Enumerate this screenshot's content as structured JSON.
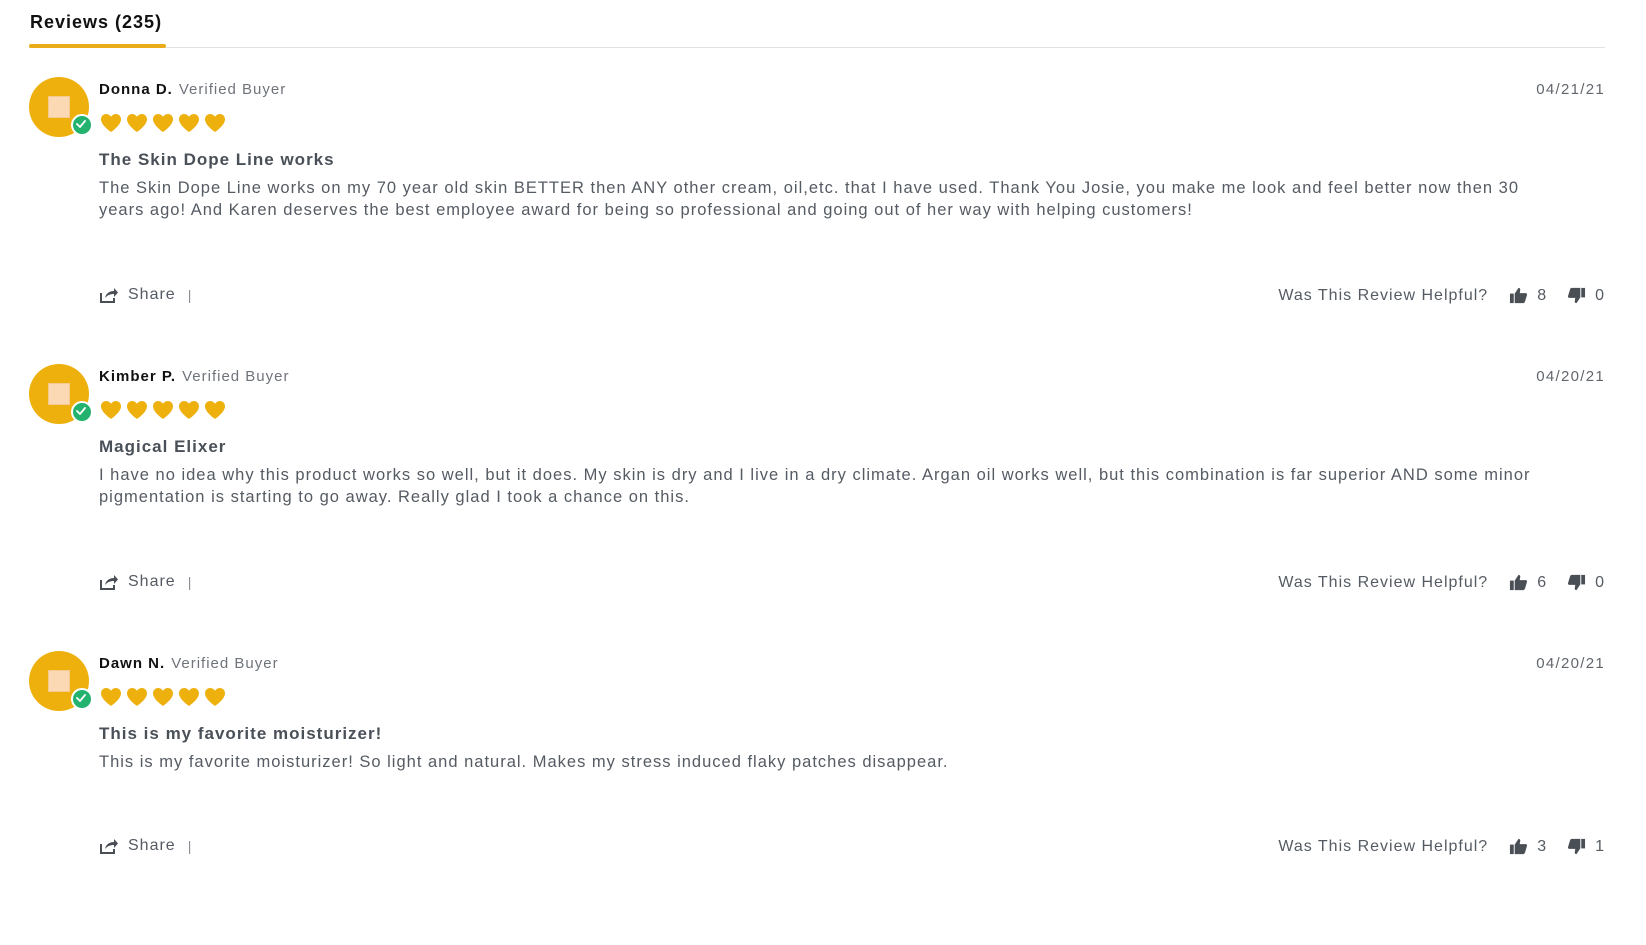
{
  "tabs": {
    "reviews_label": "Reviews (235)"
  },
  "colors": {
    "accent": "#eaac1b",
    "star": "#edb00c",
    "verified": "#23b36f"
  },
  "icons": {
    "rating": "heart-icon",
    "verified": "check-circle-icon",
    "share": "share-icon",
    "upvote": "thumbs-up-icon",
    "downvote": "thumbs-down-icon"
  },
  "reviews": [
    {
      "author": "Donna D.",
      "verified_label": "Verified Buyer",
      "date": "04/21/21",
      "rating": 5,
      "title": "The Skin Dope Line works",
      "body": "The Skin Dope Line works on my 70 year old skin BETTER then ANY other cream, oil,etc. that I have used. Thank You Josie, you make me look and feel better now then 30 years ago! And Karen deserves the best employee award for being so professional and going out of her way with helping customers!",
      "share_label": "Share",
      "divider": "|",
      "helpful_question": "Was This Review Helpful?",
      "helpful_yes": "8",
      "helpful_no": "0"
    },
    {
      "author": "Kimber P.",
      "verified_label": "Verified Buyer",
      "date": "04/20/21",
      "rating": 5,
      "title": "Magical Elixer",
      "body": "I have no idea why this product works so well, but it does. My skin is dry and I live in a dry climate. Argan oil works well, but this combination is far superior AND some minor pigmentation is starting to go away. Really glad I took a chance on this.",
      "share_label": "Share",
      "divider": "|",
      "helpful_question": "Was This Review Helpful?",
      "helpful_yes": "6",
      "helpful_no": "0"
    },
    {
      "author": "Dawn N.",
      "verified_label": "Verified Buyer",
      "date": "04/20/21",
      "rating": 5,
      "title": "This is my favorite moisturizer!",
      "body": "This is my favorite moisturizer! So light and natural. Makes my stress induced flaky patches disappear.",
      "share_label": "Share",
      "divider": "|",
      "helpful_question": "Was This Review Helpful?",
      "helpful_yes": "3",
      "helpful_no": "1"
    }
  ]
}
